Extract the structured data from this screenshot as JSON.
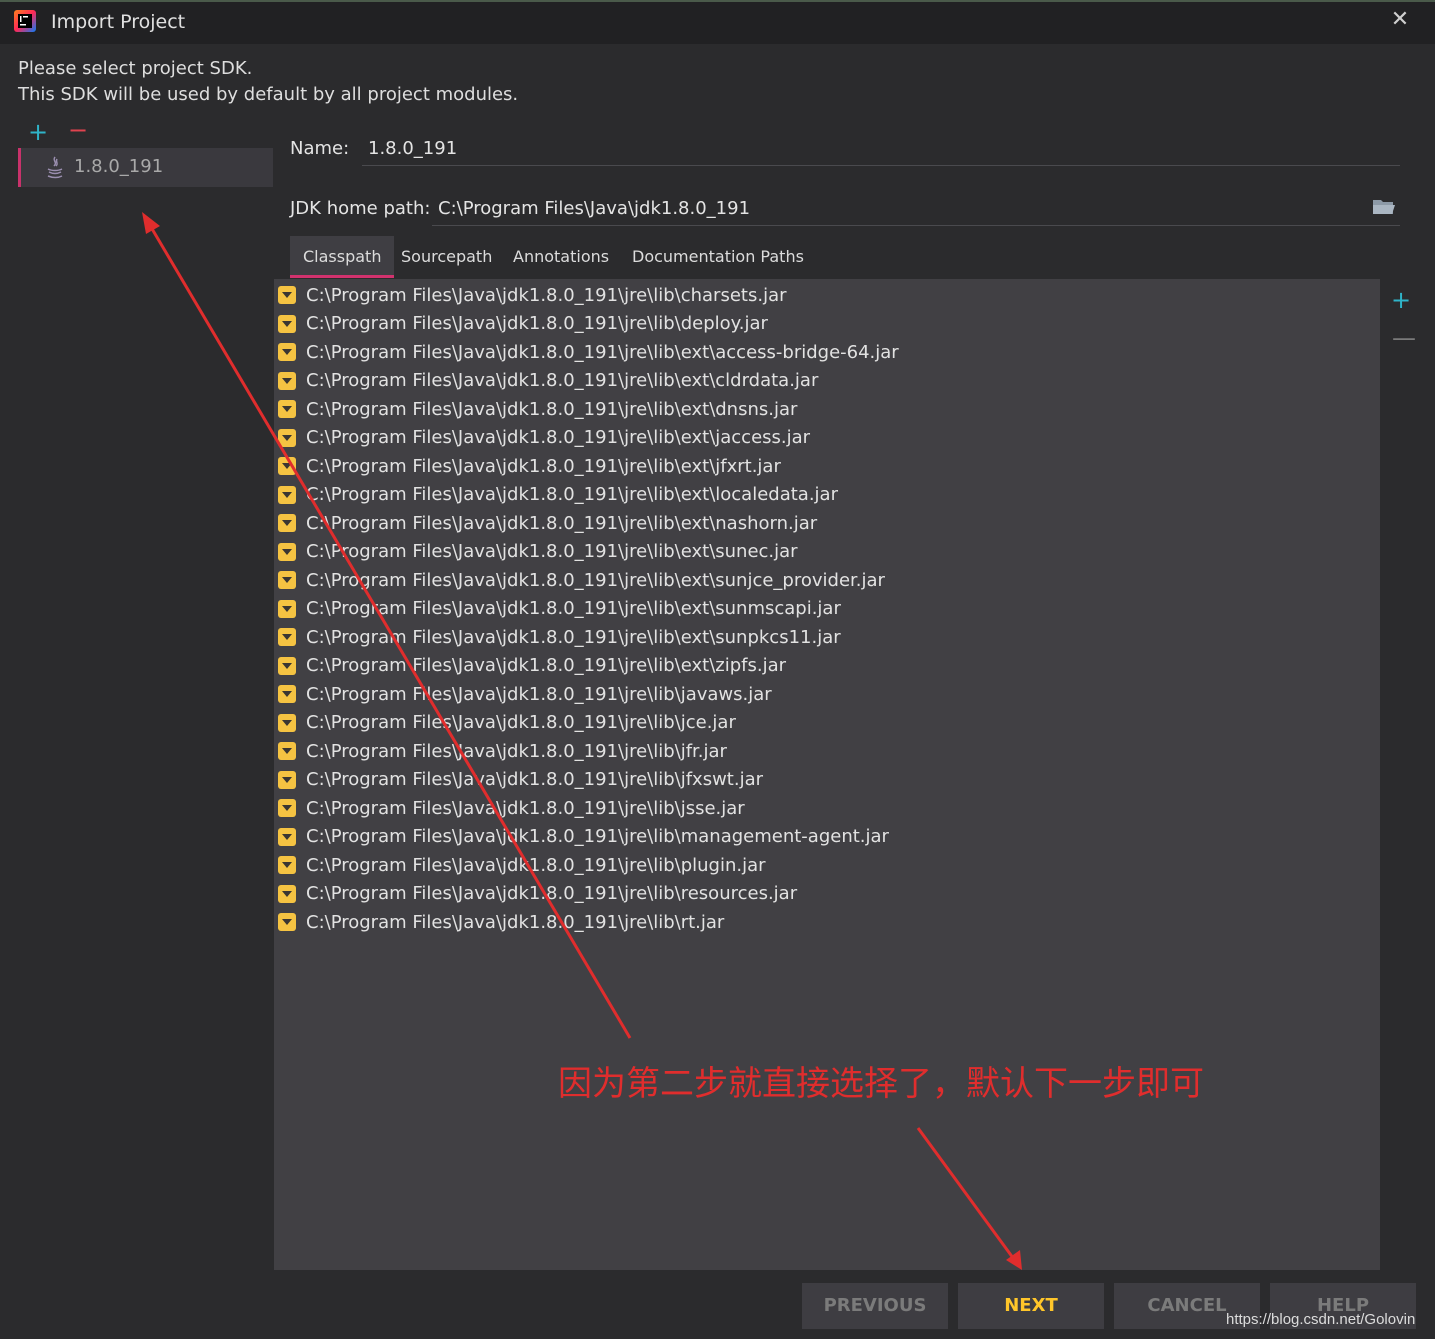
{
  "window": {
    "title": "Import Project",
    "close_icon": "close-icon"
  },
  "description": {
    "line1": "Please select project SDK.",
    "line2": "This SDK will be used by default by all project modules."
  },
  "sdk_list": {
    "add_label": "+",
    "remove_label": "−",
    "items": [
      {
        "label": "1.8.0_191",
        "icon": "java-icon",
        "selected": true
      }
    ]
  },
  "form": {
    "name_label": "Name:",
    "name_value": "1.8.0_191",
    "jdk_label": "JDK home path:",
    "jdk_value": "C:\\Program Files\\Java\\jdk1.8.0_191",
    "browse_icon": "folder-icon"
  },
  "tabs": [
    {
      "label": "Classpath",
      "active": true
    },
    {
      "label": "Sourcepath",
      "active": false
    },
    {
      "label": "Annotations",
      "active": false
    },
    {
      "label": "Documentation Paths",
      "active": false
    }
  ],
  "classpath": [
    "C:\\Program Files\\Java\\jdk1.8.0_191\\jre\\lib\\charsets.jar",
    "C:\\Program Files\\Java\\jdk1.8.0_191\\jre\\lib\\deploy.jar",
    "C:\\Program Files\\Java\\jdk1.8.0_191\\jre\\lib\\ext\\access-bridge-64.jar",
    "C:\\Program Files\\Java\\jdk1.8.0_191\\jre\\lib\\ext\\cldrdata.jar",
    "C:\\Program Files\\Java\\jdk1.8.0_191\\jre\\lib\\ext\\dnsns.jar",
    "C:\\Program Files\\Java\\jdk1.8.0_191\\jre\\lib\\ext\\jaccess.jar",
    "C:\\Program Files\\Java\\jdk1.8.0_191\\jre\\lib\\ext\\jfxrt.jar",
    "C:\\Program Files\\Java\\jdk1.8.0_191\\jre\\lib\\ext\\localedata.jar",
    "C:\\Program Files\\Java\\jdk1.8.0_191\\jre\\lib\\ext\\nashorn.jar",
    "C:\\Program Files\\Java\\jdk1.8.0_191\\jre\\lib\\ext\\sunec.jar",
    "C:\\Program Files\\Java\\jdk1.8.0_191\\jre\\lib\\ext\\sunjce_provider.jar",
    "C:\\Program Files\\Java\\jdk1.8.0_191\\jre\\lib\\ext\\sunmscapi.jar",
    "C:\\Program Files\\Java\\jdk1.8.0_191\\jre\\lib\\ext\\sunpkcs11.jar",
    "C:\\Program Files\\Java\\jdk1.8.0_191\\jre\\lib\\ext\\zipfs.jar",
    "C:\\Program Files\\Java\\jdk1.8.0_191\\jre\\lib\\javaws.jar",
    "C:\\Program Files\\Java\\jdk1.8.0_191\\jre\\lib\\jce.jar",
    "C:\\Program Files\\Java\\jdk1.8.0_191\\jre\\lib\\jfr.jar",
    "C:\\Program Files\\Java\\jdk1.8.0_191\\jre\\lib\\jfxswt.jar",
    "C:\\Program Files\\Java\\jdk1.8.0_191\\jre\\lib\\jsse.jar",
    "C:\\Program Files\\Java\\jdk1.8.0_191\\jre\\lib\\management-agent.jar",
    "C:\\Program Files\\Java\\jdk1.8.0_191\\jre\\lib\\plugin.jar",
    "C:\\Program Files\\Java\\jdk1.8.0_191\\jre\\lib\\resources.jar",
    "C:\\Program Files\\Java\\jdk1.8.0_191\\jre\\lib\\rt.jar"
  ],
  "list_actions": {
    "add_label": "+",
    "remove_label": "—"
  },
  "buttons": {
    "previous": "PREVIOUS",
    "next": "NEXT",
    "cancel": "CANCEL",
    "help": "HELP"
  },
  "annotation": {
    "text": "因为第二步就直接选择了，默认下一步即可",
    "color": "#e02d2d"
  },
  "watermark": "https://blog.csdn.net/Golovin",
  "colors": {
    "accent_pink": "#d2326e",
    "add_cyan": "#2fb4c9",
    "remove_red": "#e0434f",
    "jar_yellow": "#f5c342",
    "next_yellow": "#ffc62a"
  }
}
